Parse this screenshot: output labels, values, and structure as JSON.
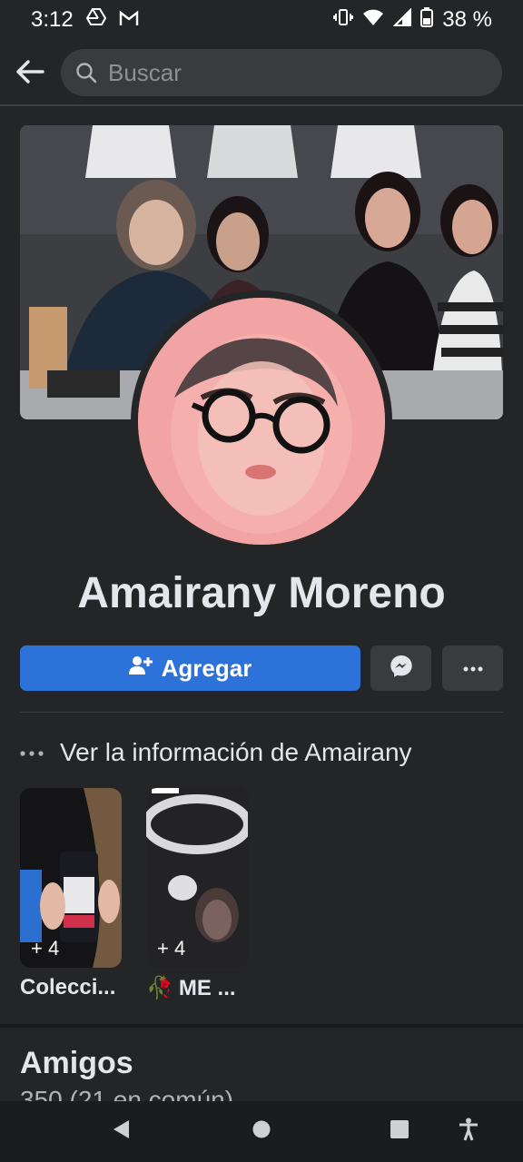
{
  "status_bar": {
    "time": "3:12",
    "battery": "38 %"
  },
  "search": {
    "placeholder": "Buscar"
  },
  "profile": {
    "name": "Amairany Moreno",
    "add_label": "Agregar",
    "info_label": "Ver la información de Amairany"
  },
  "highlights": [
    {
      "count": "+ 4",
      "label": "Colecci..."
    },
    {
      "count": "+ 4",
      "label": "ME ...",
      "emoji": "🥀"
    }
  ],
  "friends": {
    "title": "Amigos",
    "subtitle": "350 (21 en común)"
  },
  "colors": {
    "background": "#242526",
    "primary": "#2d72d9",
    "secondary_button": "#3a3b3c",
    "avatar_bg": "#f2a3a3"
  },
  "icons": [
    "drive-icon",
    "gmail-icon",
    "vibrate-icon",
    "wifi-icon",
    "signal-icon",
    "battery-icon",
    "back-arrow-icon",
    "search-icon",
    "add-friend-icon",
    "messenger-icon",
    "more-icon",
    "nav-back-icon",
    "nav-home-icon",
    "nav-recents-icon",
    "accessibility-icon"
  ]
}
